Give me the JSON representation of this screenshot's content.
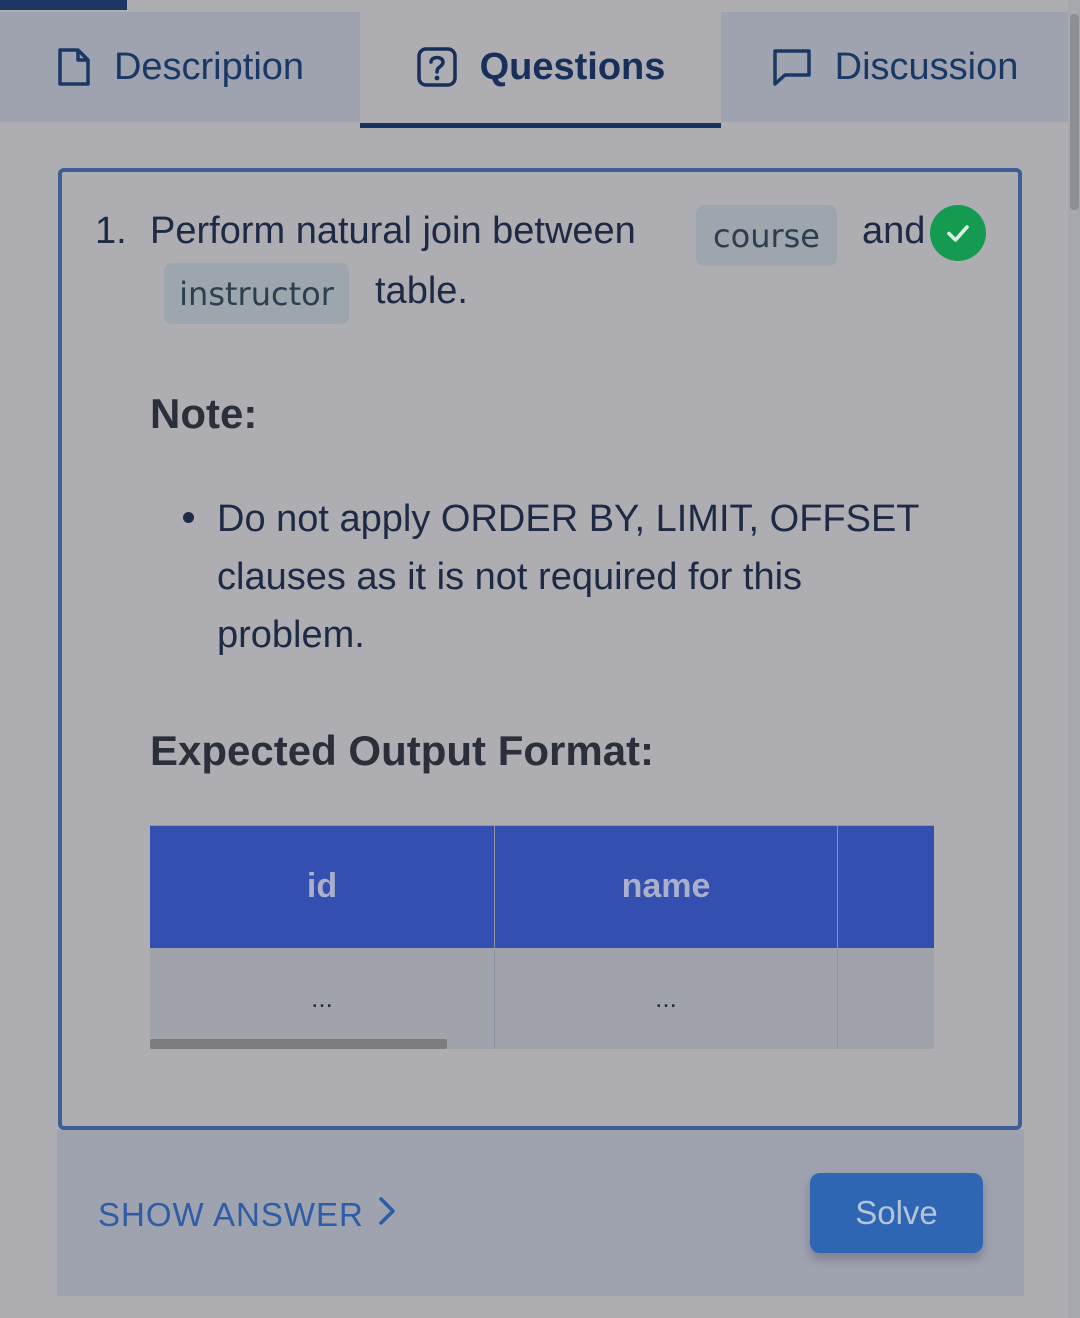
{
  "tabs": [
    {
      "label": "Description",
      "icon": "document-icon",
      "active": false
    },
    {
      "label": "Questions",
      "icon": "question-icon",
      "active": true
    },
    {
      "label": "Discussion",
      "icon": "chat-icon",
      "active": false
    }
  ],
  "question": {
    "number": "1.",
    "text_before": "Perform natural join between",
    "code_1": "course",
    "text_middle": "and",
    "code_2": "instructor",
    "text_after": "table.",
    "status_icon": "check-circle-icon"
  },
  "note": {
    "heading": "Note:",
    "items": [
      "Do not apply ORDER BY, LIMIT, OFFSET clauses as it is not required for this problem."
    ]
  },
  "output": {
    "heading": "Expected Output Format:",
    "columns": [
      "id",
      "name",
      ""
    ],
    "rows": [
      [
        "...",
        "...",
        ""
      ]
    ]
  },
  "actions": {
    "show_answer": "SHOW ANSWER",
    "solve": "Solve"
  },
  "colors": {
    "accent": "#334fb0",
    "success": "#159a52",
    "link": "#2d5da6"
  }
}
